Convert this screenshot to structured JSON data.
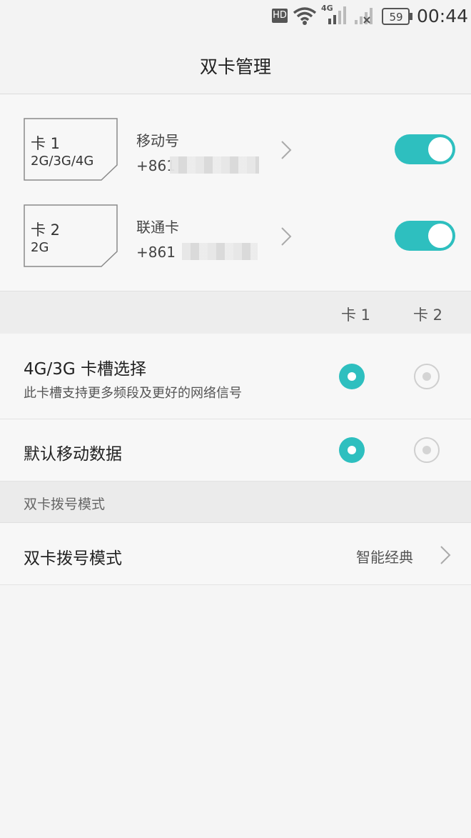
{
  "status_bar": {
    "hd": "HD",
    "network": "4G",
    "battery": "59",
    "time": "00:44"
  },
  "header": {
    "title": "双卡管理"
  },
  "sims": [
    {
      "slot_label": "卡 1",
      "type": "2G/3G/4G",
      "carrier": "移动号",
      "number_visible": "+861",
      "enabled": true
    },
    {
      "slot_label": "卡 2",
      "type": "2G",
      "carrier": "联通卡",
      "number_visible": "+861",
      "enabled": true
    }
  ],
  "columns": {
    "card1": "卡 1",
    "card2": "卡 2"
  },
  "options": {
    "slot_select": {
      "title": "4G/3G 卡槽选择",
      "subtitle": "此卡槽支持更多频段及更好的网络信号",
      "selected": "card1"
    },
    "default_data": {
      "title": "默认移动数据",
      "selected": "card1"
    }
  },
  "dial_section": {
    "header": "双卡拨号模式",
    "row_label": "双卡拨号模式",
    "row_value": "智能经典"
  },
  "colors": {
    "accent": "#2ebfbf",
    "background": "#f5f5f5"
  }
}
